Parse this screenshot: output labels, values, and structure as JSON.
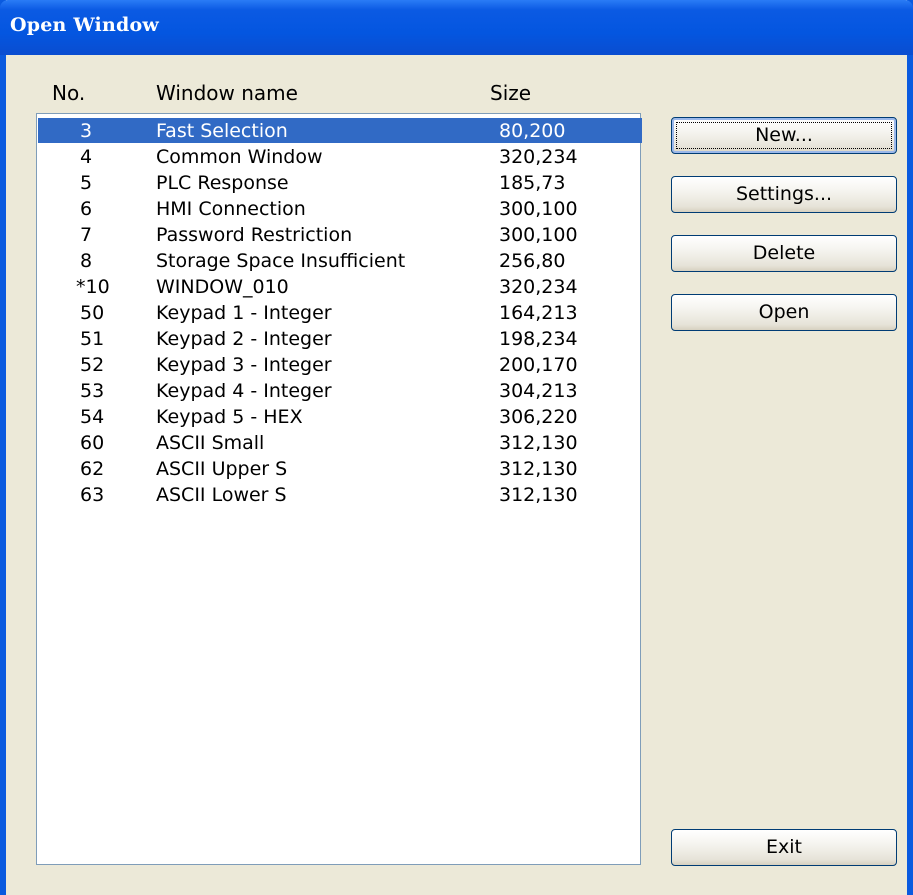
{
  "window": {
    "title": "Open Window"
  },
  "columns": {
    "no": "No.",
    "name": "Window name",
    "size": "Size"
  },
  "rows": [
    {
      "no": "3",
      "name": "Fast Selection",
      "size": "80,200",
      "selected": true
    },
    {
      "no": "4",
      "name": "Common Window",
      "size": "320,234"
    },
    {
      "no": "5",
      "name": "PLC Response",
      "size": "185,73"
    },
    {
      "no": "6",
      "name": "HMI Connection",
      "size": "300,100"
    },
    {
      "no": "7",
      "name": "Password Restriction",
      "size": "300,100"
    },
    {
      "no": "8",
      "name": "Storage Space Insufficient",
      "size": "256,80"
    },
    {
      "no": "*10",
      "name": "WINDOW_010",
      "size": "320,234"
    },
    {
      "no": "50",
      "name": "Keypad 1 - Integer",
      "size": "164,213"
    },
    {
      "no": "51",
      "name": "Keypad 2 - Integer",
      "size": "198,234"
    },
    {
      "no": "52",
      "name": "Keypad 3 - Integer",
      "size": "200,170"
    },
    {
      "no": "53",
      "name": "Keypad 4 - Integer",
      "size": "304,213"
    },
    {
      "no": "54",
      "name": "Keypad 5 - HEX",
      "size": "306,220"
    },
    {
      "no": "60",
      "name": "ASCII Small",
      "size": "312,130"
    },
    {
      "no": "62",
      "name": "ASCII Upper S",
      "size": "312,130"
    },
    {
      "no": "63",
      "name": "ASCII Lower S",
      "size": "312,130"
    }
  ],
  "buttons": {
    "new": "New...",
    "settings": "Settings...",
    "delete": "Delete",
    "open": "Open",
    "exit": "Exit"
  },
  "colors": {
    "titlebar": "#0456e0",
    "selection": "#316ac5",
    "dialog_bg": "#ece9d8"
  }
}
